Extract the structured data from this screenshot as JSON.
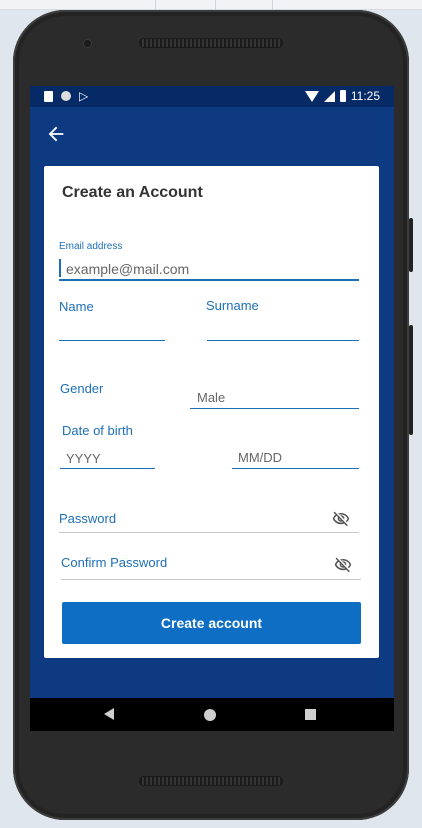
{
  "status_bar": {
    "time": "11:25"
  },
  "app_bar": {
    "back_icon": "arrow-left-icon"
  },
  "form": {
    "title": "Create an Account",
    "email_label": "Email address",
    "email_placeholder": "example@mail.com",
    "name_label": "Name",
    "surname_label": "Surname",
    "gender_label": "Gender",
    "gender_value": "Male",
    "dob_label": "Date of birth",
    "dob_year_placeholder": "YYYY",
    "dob_monthday_placeholder": "MM/DD",
    "password_label": "Password",
    "confirm_password_label": "Confirm Password",
    "submit_label": "Create account"
  },
  "colors": {
    "accent": "#1d6fb8",
    "app_bar": "#0e3a82",
    "button": "#0d6ec4"
  }
}
